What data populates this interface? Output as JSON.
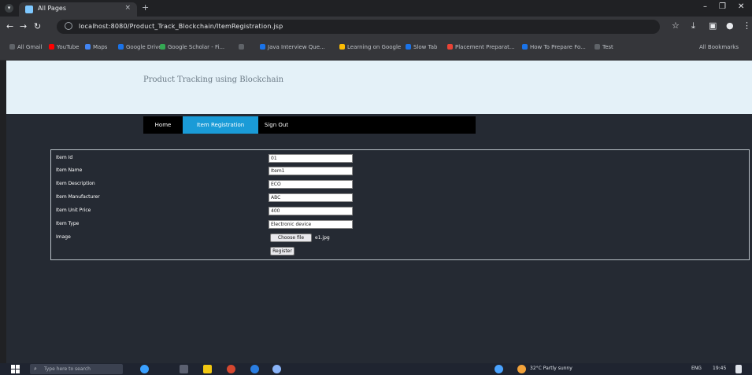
{
  "browser": {
    "tab_title": "All Pages",
    "tab_close": "×",
    "new_tab": "+",
    "url": "localhost:8080/Product_Track_Blockchain/ItemRegistration.jsp",
    "window_controls": [
      "–",
      "❐",
      "✕"
    ],
    "bookmarks": [
      {
        "label": "All Gmail",
        "color": "#5f6368"
      },
      {
        "label": "YouTube",
        "color": "#ff0000"
      },
      {
        "label": "Maps",
        "color": "#4285f4"
      },
      {
        "label": "Google Drive",
        "color": "#1a73e8"
      },
      {
        "label": "Google Scholar - Fi...",
        "color": "#34a853"
      },
      {
        "label": "",
        "color": "#5f6368"
      },
      {
        "label": "Java Interview Que...",
        "color": "#1a73e8"
      },
      {
        "label": "Learning on Google",
        "color": "#fbbc04"
      },
      {
        "label": "Slow Tab",
        "color": "#1a73e8"
      },
      {
        "label": "Placement Preparat...",
        "color": "#ea4335"
      },
      {
        "label": "How To Prepare Fo...",
        "color": "#1a73e8"
      },
      {
        "label": "Test",
        "color": "#5f6368"
      }
    ],
    "all_bookmarks": "All Bookmarks"
  },
  "site": {
    "title": "Product Tracking using Blockchain",
    "nav": [
      {
        "label": "Home"
      },
      {
        "label": "Item Registration"
      },
      {
        "label": "Sign Out"
      }
    ]
  },
  "form": {
    "fields": [
      {
        "label": "Item Id",
        "value": "01"
      },
      {
        "label": "Item Name",
        "value": "Item1"
      },
      {
        "label": "Item Description",
        "value": "ECO"
      },
      {
        "label": "Item Manufacturer",
        "value": "ABC"
      },
      {
        "label": "Item Unit Price",
        "value": "400"
      },
      {
        "label": "Item Type",
        "value": "Electronic device"
      }
    ],
    "image_label": "Image",
    "file_button": "Choose file",
    "file_name": "e1.jpg",
    "submit": "Register"
  },
  "taskbar": {
    "search_placeholder": "Type here to search",
    "weather": "32°C Partly sunny",
    "tray": "ENG",
    "time": "19:45"
  }
}
